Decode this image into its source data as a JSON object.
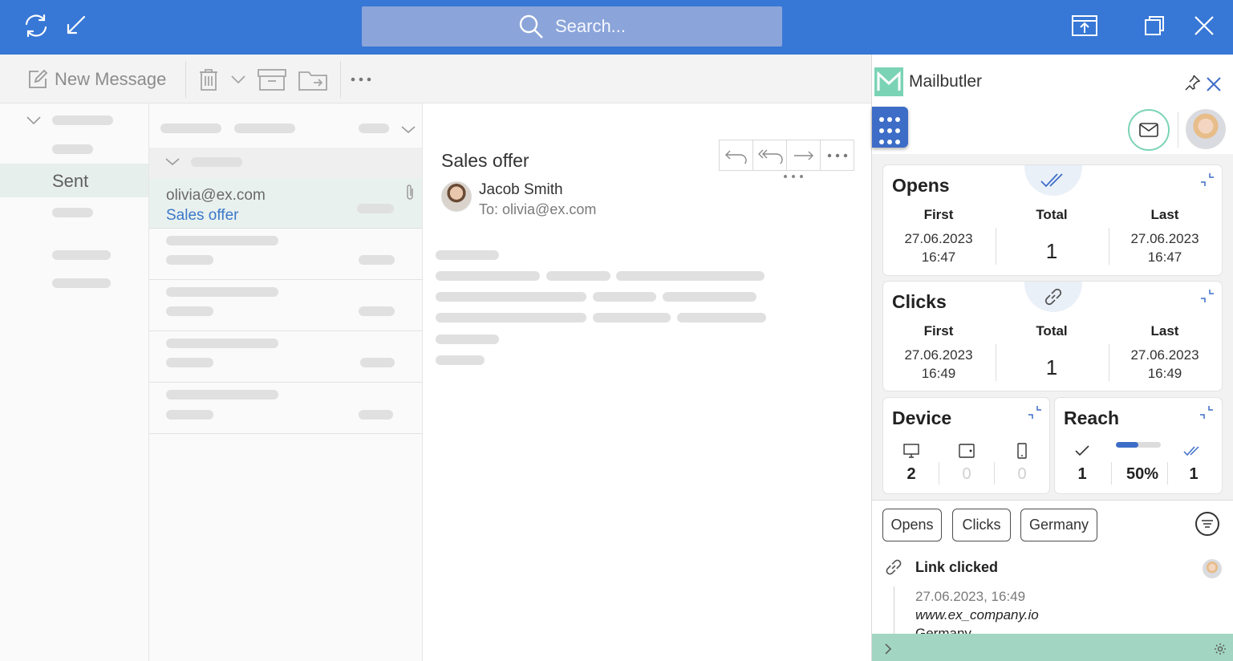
{
  "titlebar": {
    "search_placeholder": "Search...",
    "accent_color": "#3777d6"
  },
  "toolbar": {
    "new_message_label": "New Message"
  },
  "folders": {
    "selected_label": "Sent"
  },
  "message_list": {
    "selected_from": "olivia@ex.com",
    "selected_subject": "Sales offer"
  },
  "reading": {
    "subject": "Sales offer",
    "sender_name": "Jacob Smith",
    "to_line": "To: olivia@ex.com"
  },
  "mailbutler": {
    "title": "Mailbutler",
    "brand_color": "#7bd3b6",
    "opens": {
      "title": "Opens",
      "first_label": "First",
      "first_date": "27.06.2023",
      "first_time": "16:47",
      "total_label": "Total",
      "total_value": "1",
      "last_label": "Last",
      "last_date": "27.06.2023",
      "last_time": "16:47"
    },
    "clicks": {
      "title": "Clicks",
      "first_label": "First",
      "first_date": "27.06.2023",
      "first_time": "16:49",
      "total_label": "Total",
      "total_value": "1",
      "last_label": "Last",
      "last_date": "27.06.2023",
      "last_time": "16:49"
    },
    "device": {
      "title": "Device",
      "desktop": "2",
      "tablet": "0",
      "mobile": "0"
    },
    "reach": {
      "title": "Reach",
      "sent": "1",
      "percent": "50%",
      "percent_fraction": 0.5,
      "read": "1"
    },
    "filters": {
      "opens": "Opens",
      "clicks": "Clicks",
      "country": "Germany"
    },
    "event": {
      "title": "Link clicked",
      "datetime": "27.06.2023, 16:49",
      "url": "www.ex_company.io",
      "country": "Germany"
    }
  }
}
